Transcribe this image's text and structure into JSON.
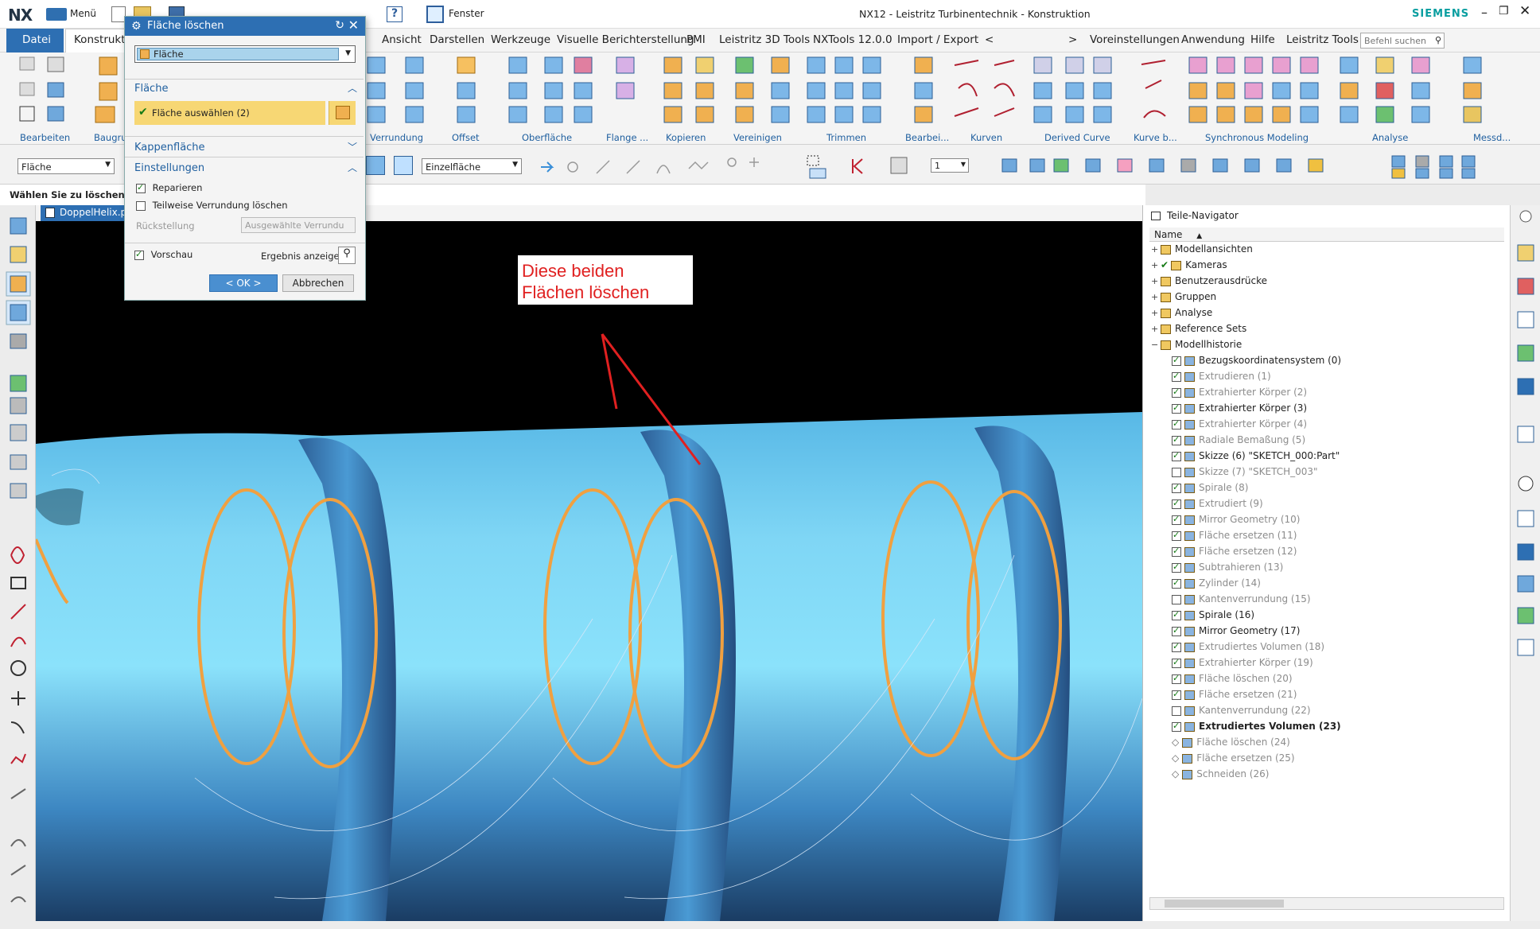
{
  "app": {
    "logo": "NX",
    "menu_label": "Menü",
    "window_menu_label": "Fenster",
    "title": "NX12 - Leistritz Turbinentechnik - Konstruktion",
    "brand": "SIEMENS",
    "search_placeholder": "Befehl suchen"
  },
  "tabs": [
    "Datei",
    "Konstruktion",
    "Ansicht",
    "Darstellen",
    "Werkzeuge",
    "Visuelle Berichterstellung",
    "PMI",
    "Leistritz 3D Tools",
    "NXTools 12.0.0",
    "Import / Export",
    "<",
    ">",
    "Voreinstellungen",
    "Anwendung",
    "Hilfe",
    "Leistritz Tools"
  ],
  "ribbon_groups": [
    "Bearbeiten",
    "Baugru...",
    "Verrundung",
    "Offset",
    "Oberfläche",
    "Flange ...",
    "Kopieren",
    "Vereinigen",
    "Trimmen",
    "Bearbei...",
    "Kurven",
    "Derived Curve",
    "Kurve b...",
    "Synchronous Modeling",
    "Analyse",
    "Messd..."
  ],
  "selection": {
    "type_filter": "Fläche",
    "face_rule": "Einzelfläche",
    "layer": "1"
  },
  "cue_line": "Wählen Sie zu löschende Flä",
  "document_tab": "DoppelHelix.prt",
  "dialog": {
    "title": "Fläche löschen",
    "type_value": "Fläche",
    "section_face": "Fläche",
    "select_face": "Fläche auswählen (2)",
    "section_cap": "Kappenfläche",
    "section_settings": "Einstellungen",
    "repair": "Reparieren",
    "partial_blend": "Teilweise Verrundung löschen",
    "setback_label": "Rückstellung",
    "setback_value": "Ausgewählte Verrundu",
    "preview": "Vorschau",
    "show_result": "Ergebnis anzeigen",
    "ok": "< OK >",
    "cancel": "Abbrechen"
  },
  "annotation": {
    "line1": "Diese beiden",
    "line2": "Flächen löschen"
  },
  "navigator": {
    "title": "Teile-Navigator",
    "column": "Name",
    "items": [
      {
        "label": "Modellansichten",
        "indent": 0,
        "state": "none",
        "dim": false,
        "bold": false
      },
      {
        "label": "Kameras",
        "indent": 0,
        "state": "tick",
        "dim": false,
        "bold": false
      },
      {
        "label": "Benutzerausdrücke",
        "indent": 0,
        "state": "none",
        "dim": false,
        "bold": false
      },
      {
        "label": "Gruppen",
        "indent": 0,
        "state": "none",
        "dim": false,
        "bold": false
      },
      {
        "label": "Analyse",
        "indent": 0,
        "state": "none",
        "dim": false,
        "bold": false
      },
      {
        "label": "Reference Sets",
        "indent": 0,
        "state": "none",
        "dim": false,
        "bold": false
      },
      {
        "label": "Modellhistorie",
        "indent": 0,
        "state": "none",
        "dim": false,
        "bold": false
      },
      {
        "label": "Bezugskoordinatensystem (0)",
        "indent": 1,
        "state": "on",
        "dim": false,
        "bold": false
      },
      {
        "label": "Extrudieren (1)",
        "indent": 1,
        "state": "on",
        "dim": true,
        "bold": false
      },
      {
        "label": "Extrahierter Körper (2)",
        "indent": 1,
        "state": "on",
        "dim": true,
        "bold": false
      },
      {
        "label": "Extrahierter Körper (3)",
        "indent": 1,
        "state": "on",
        "dim": false,
        "bold": false
      },
      {
        "label": "Extrahierter Körper (4)",
        "indent": 1,
        "state": "on",
        "dim": true,
        "bold": false
      },
      {
        "label": "Radiale Bemaßung (5)",
        "indent": 1,
        "state": "on",
        "dim": true,
        "bold": false
      },
      {
        "label": "Skizze (6) \"SKETCH_000:Part\"",
        "indent": 1,
        "state": "on",
        "dim": false,
        "bold": false
      },
      {
        "label": "Skizze (7) \"SKETCH_003\"",
        "indent": 1,
        "state": "off",
        "dim": true,
        "bold": false
      },
      {
        "label": "Spirale (8)",
        "indent": 1,
        "state": "on",
        "dim": true,
        "bold": false
      },
      {
        "label": "Extrudiert (9)",
        "indent": 1,
        "state": "on",
        "dim": true,
        "bold": false
      },
      {
        "label": "Mirror Geometry (10)",
        "indent": 1,
        "state": "on",
        "dim": true,
        "bold": false
      },
      {
        "label": "Fläche ersetzen (11)",
        "indent": 1,
        "state": "on",
        "dim": true,
        "bold": false
      },
      {
        "label": "Fläche ersetzen (12)",
        "indent": 1,
        "state": "on",
        "dim": true,
        "bold": false
      },
      {
        "label": "Subtrahieren (13)",
        "indent": 1,
        "state": "on",
        "dim": true,
        "bold": false
      },
      {
        "label": "Zylinder (14)",
        "indent": 1,
        "state": "on",
        "dim": true,
        "bold": false
      },
      {
        "label": "Kantenverrundung (15)",
        "indent": 1,
        "state": "off",
        "dim": true,
        "bold": false
      },
      {
        "label": "Spirale (16)",
        "indent": 1,
        "state": "on",
        "dim": false,
        "bold": false
      },
      {
        "label": "Mirror Geometry (17)",
        "indent": 1,
        "state": "on",
        "dim": false,
        "bold": false
      },
      {
        "label": "Extrudiertes Volumen (18)",
        "indent": 1,
        "state": "on",
        "dim": true,
        "bold": false
      },
      {
        "label": "Extrahierter Körper (19)",
        "indent": 1,
        "state": "on",
        "dim": true,
        "bold": false
      },
      {
        "label": "Fläche löschen (20)",
        "indent": 1,
        "state": "on",
        "dim": true,
        "bold": false
      },
      {
        "label": "Fläche ersetzen (21)",
        "indent": 1,
        "state": "on",
        "dim": true,
        "bold": false
      },
      {
        "label": "Kantenverrundung (22)",
        "indent": 1,
        "state": "off",
        "dim": true,
        "bold": false
      },
      {
        "label": "Extrudiertes Volumen (23)",
        "indent": 1,
        "state": "on",
        "dim": false,
        "bold": true
      },
      {
        "label": "Fläche löschen (24)",
        "indent": 1,
        "state": "dash",
        "dim": true,
        "bold": false
      },
      {
        "label": "Fläche ersetzen (25)",
        "indent": 1,
        "state": "dash",
        "dim": true,
        "bold": false
      },
      {
        "label": "Schneiden (26)",
        "indent": 1,
        "state": "dash",
        "dim": true,
        "bold": false
      }
    ]
  },
  "colors": {
    "accent": "#1f5f9f",
    "tab_active": "#2d6fb3",
    "face": "#7fd6f5",
    "helix": "#f0a040",
    "annotation": "#e02020",
    "select_highlight": "#f7d774"
  }
}
